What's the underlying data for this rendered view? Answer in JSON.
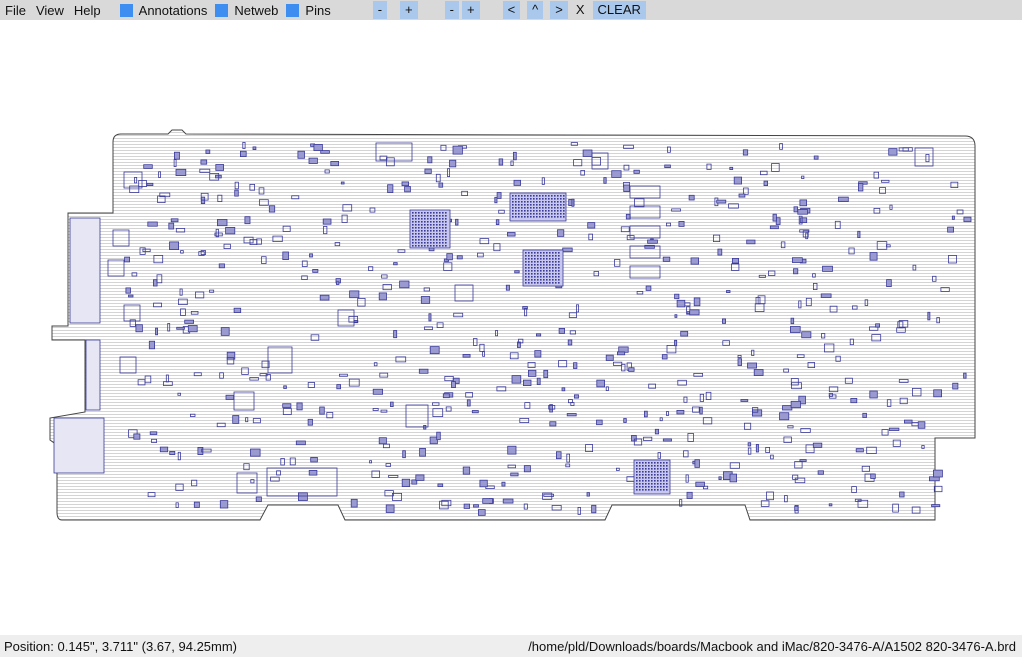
{
  "menu": {
    "file": "File",
    "view": "View",
    "help": "Help"
  },
  "toggles": {
    "annotations": "Annotations",
    "netweb": "Netweb",
    "pins": "Pins"
  },
  "buttons": {
    "zoom_out": "-",
    "zoom_in": "+",
    "zoom_out2": "-",
    "zoom_in2": "+",
    "prev": "<",
    "up": "^",
    "next": ">",
    "close": "X",
    "clear": "CLEAR"
  },
  "colors": {
    "accent": "#3d8ef0",
    "button": "#a9c8ec",
    "component": "#3a3a9a",
    "outline": "#444444"
  },
  "status": {
    "position": "Position: 0.145\", 3.711\" (3.67, 94.25mm)",
    "file": "/home/pld/Downloads/boards/Macbook and iMac/820-3476-A/A1502 820-3476-A.brd"
  }
}
